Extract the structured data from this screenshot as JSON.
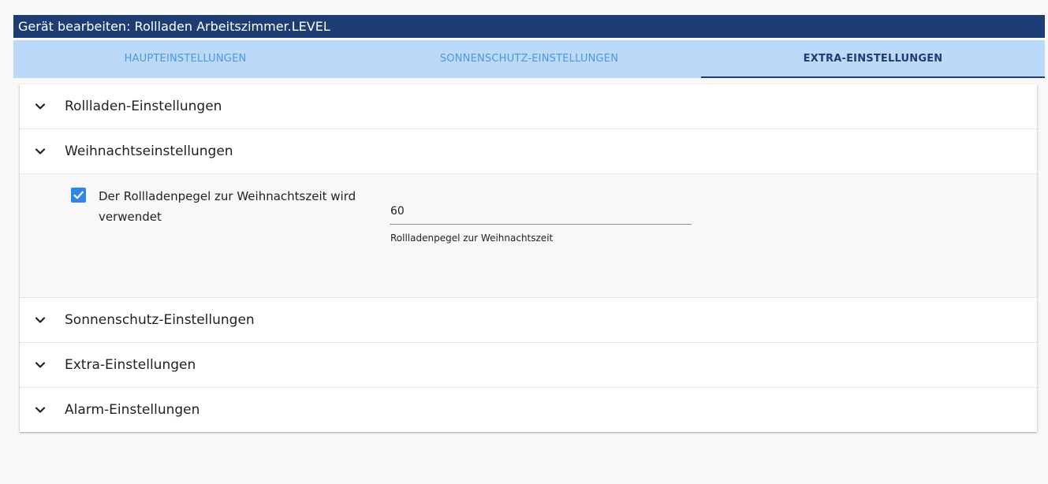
{
  "window": {
    "title": "Gerät bearbeiten: Rollladen Arbeitszimmer.LEVEL"
  },
  "tabs": [
    {
      "label": "HAUPTEINSTELLUNGEN",
      "active": false
    },
    {
      "label": "SONNENSCHUTZ-EINSTELLUNGEN",
      "active": false
    },
    {
      "label": "EXTRA-EINSTELLUNGEN",
      "active": true
    }
  ],
  "sections": [
    {
      "title": "Rollladen-Einstellungen",
      "expanded": false
    },
    {
      "title": "Weihnachtseinstellungen",
      "expanded": true
    },
    {
      "title": "Sonnenschutz-Einstellungen",
      "expanded": false
    },
    {
      "title": "Extra-Einstellungen",
      "expanded": false
    },
    {
      "title": "Alarm-Einstellungen",
      "expanded": false
    }
  ],
  "christmas": {
    "checkbox_label": "Der Rollladenpegel zur Weihnachtszeit wird verwendet",
    "checked": true,
    "level_value": "60",
    "level_helper": "Rollladenpegel zur Weihnachtszeit"
  },
  "icons": {
    "chevron": "chevron-down-icon",
    "check": "check-icon"
  },
  "colors": {
    "title_bar": "#1d3d74",
    "tab_bar": "#bcdaf7",
    "tab_inactive": "#4d95e2",
    "tab_active": "#1d3d74",
    "checkbox": "#2d86e8"
  }
}
